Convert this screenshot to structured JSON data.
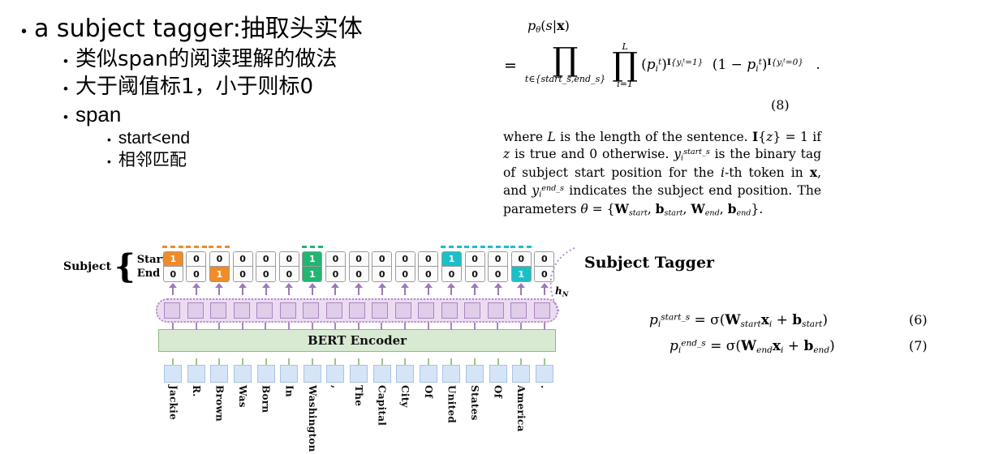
{
  "slide": {
    "bullets": [
      {
        "level": 1,
        "text": "a subject tagger:抽取头实体"
      },
      {
        "level": 2,
        "text": "类似span的阅读理解的做法"
      },
      {
        "level": 2,
        "text": "大于阈值标1，小于则标0"
      },
      {
        "level": 2,
        "text": "span"
      },
      {
        "level": 3,
        "text": "start<end"
      },
      {
        "level": 3,
        "text": "相邻匹配"
      }
    ]
  },
  "paper": {
    "equation8": {
      "lhs": "p_theta(s|x)",
      "number": "(8)",
      "product_outer_limit": "t∈{start_s,end_s}",
      "product_inner_lower": "i=1",
      "product_inner_upper": "L",
      "body": "(p_i^t)^I{y_i^t=1} (1 − p_i^t)^I{y_i^t=0} ."
    },
    "prose": "where L is the length of the sentence. I{z} = 1 if z is true and 0 otherwise. y_i^{start_s} is the binary tag of subject start position for the i-th token in x, and y_i^{end_s} indicates the subject end position. The parameters θ = {W_start, b_start, W_end, b_end}.",
    "equation6": {
      "number": "(6)",
      "text": "p_i^{start_s} = σ(W_start x_i + b_start)"
    },
    "equation7": {
      "number": "(7)",
      "text": "p_i^{end_s} = σ(W_end x_i + b_end)"
    },
    "subject_tagger_label": "Subject Tagger"
  },
  "diagram": {
    "subject_label": "Subject",
    "row_labels": [
      "Start",
      "End"
    ],
    "encoder_label": "BERT Encoder",
    "hidden_state_label": "hN",
    "tokens": [
      "Jackie",
      "R.",
      "Brown",
      "Was",
      "Born",
      "In",
      "Washington",
      ",",
      "The",
      "Capital",
      "City",
      "Of",
      "United",
      "States",
      "Of",
      "America",
      "."
    ],
    "start_tags": [
      1,
      0,
      0,
      0,
      0,
      0,
      1,
      0,
      0,
      0,
      0,
      0,
      1,
      0,
      0,
      0,
      0
    ],
    "end_tags": [
      0,
      0,
      1,
      0,
      0,
      0,
      1,
      0,
      0,
      0,
      0,
      0,
      0,
      0,
      0,
      1,
      0
    ],
    "highlight_colors": [
      "#f08c28",
      "",
      "#f08c28",
      "",
      "",
      "",
      "#22b573",
      "",
      "",
      "",
      "",
      "",
      "#1ac0c8",
      "",
      "",
      "#1ac0c8",
      ""
    ],
    "spans": [
      {
        "start_index": 0,
        "end_index": 2,
        "color": "#f08c28"
      },
      {
        "start_index": 6,
        "end_index": 6,
        "color": "#22b573"
      },
      {
        "start_index": 12,
        "end_index": 15,
        "color": "#1ac0c8"
      }
    ],
    "colors": {
      "span_orange": "#f08c28",
      "span_green": "#22b573",
      "span_cyan": "#1ac0c8",
      "hidden_state": "#e0cde9",
      "encoder": "#d9ead3",
      "token": "#d6e4f7",
      "arrow": "#9a7ab8"
    }
  }
}
